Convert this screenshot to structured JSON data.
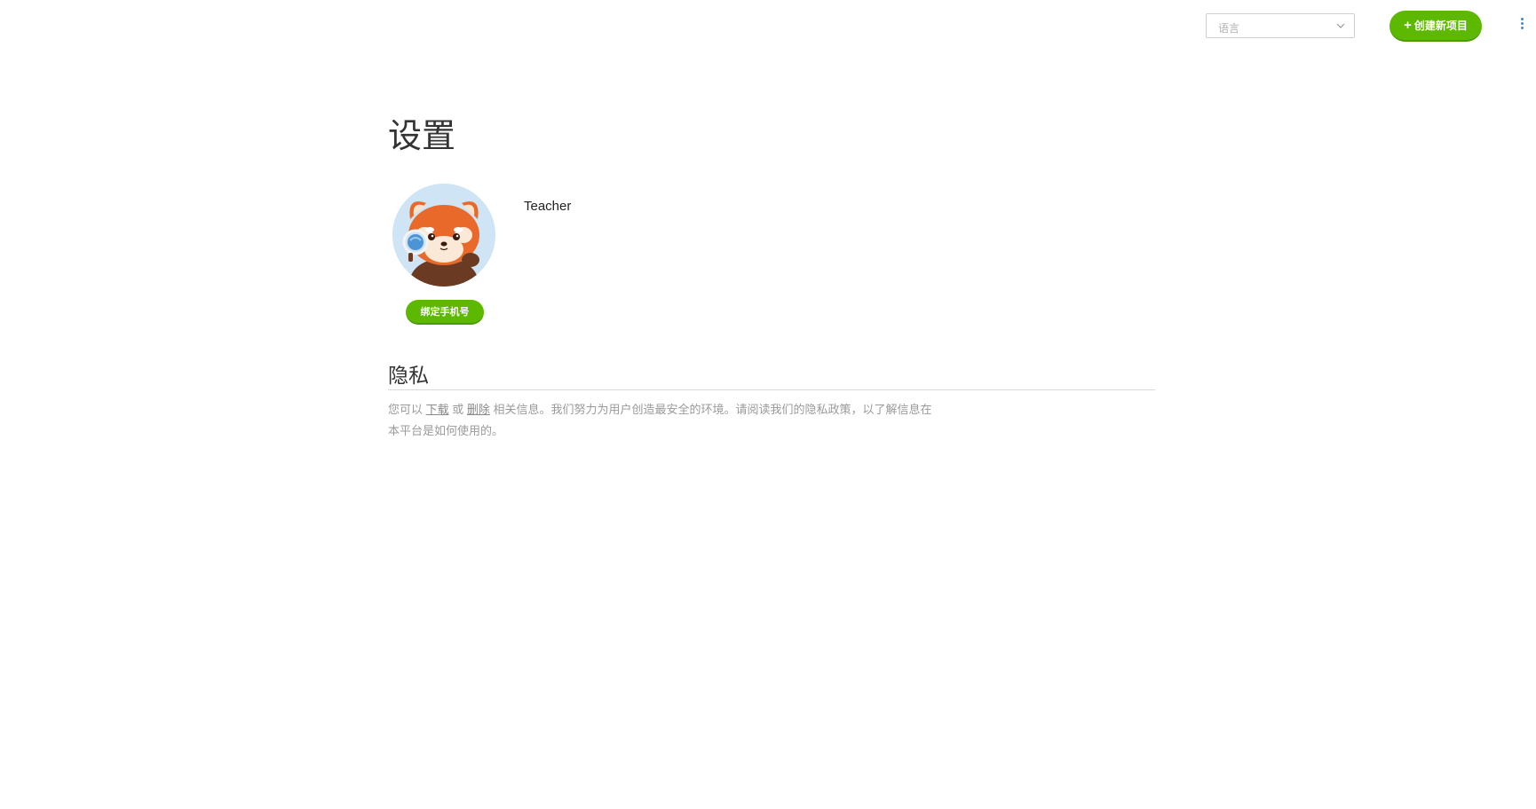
{
  "header": {
    "language_placeholder": "语言",
    "create_button_label": "创建新项目",
    "create_button_icon": "plus-icon",
    "more_icon": "vertical-ellipsis-icon"
  },
  "page": {
    "title": "设置"
  },
  "profile": {
    "username": "Teacher",
    "avatar_icon": "red-panda-avatar",
    "bind_phone_label": "绑定手机号"
  },
  "privacy": {
    "title": "隐私",
    "text_before": "您可以 ",
    "download_link": "下载",
    "text_or": " 或 ",
    "delete_link": "删除",
    "text_after": " 相关信息。我们努力为用户创造最安全的环境。请阅读我们的隐私政策，以了解信息在本平台是如何使用的。"
  },
  "colors": {
    "accent_green": "#5cb800",
    "more_icon_blue": "#3a8fd8"
  }
}
